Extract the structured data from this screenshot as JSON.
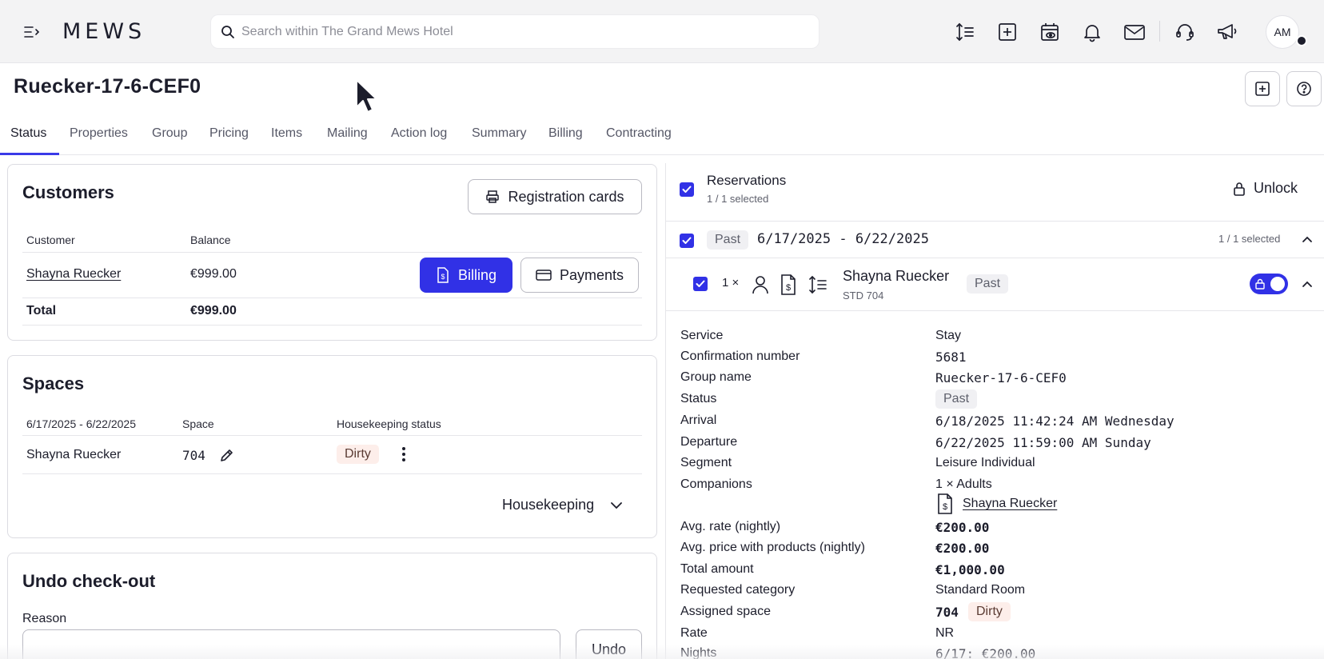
{
  "topbar": {
    "logo": "MEWS",
    "search_placeholder": "Search within The Grand Mews Hotel",
    "avatar_initials": "AM"
  },
  "header": {
    "title": "Ruecker-17-6-CEF0"
  },
  "tabs": [
    "Status",
    "Properties",
    "Group",
    "Pricing",
    "Items",
    "Mailing",
    "Action log",
    "Summary",
    "Billing",
    "Contracting"
  ],
  "customers": {
    "title": "Customers",
    "registration_cards_label": "Registration cards",
    "col_customer": "Customer",
    "col_balance": "Balance",
    "rows": [
      {
        "name": "Shayna Ruecker",
        "balance": "€999.00"
      }
    ],
    "billing_label": "Billing",
    "payments_label": "Payments",
    "total_label": "Total",
    "total_value": "€999.00"
  },
  "spaces": {
    "title": "Spaces",
    "col_dates": "6/17/2025 - 6/22/2025",
    "col_space": "Space",
    "col_hk": "Housekeeping status",
    "row": {
      "guest": "Shayna Ruecker",
      "space": "704",
      "status": "Dirty"
    },
    "housekeeping_label": "Housekeeping"
  },
  "undo_checkout": {
    "title": "Undo check-out",
    "reason_label": "Reason",
    "undo_label": "Undo"
  },
  "reservations": {
    "title": "Reservations",
    "selected": "1 / 1 selected",
    "unlock_label": "Unlock",
    "group_badge": "Past",
    "group_dates": "6/17/2025 - 6/22/2025",
    "group_selected": "1 / 1 selected",
    "item_count": "1 ×",
    "guest_name": "Shayna Ruecker",
    "room_code": "STD 704",
    "item_badge": "Past",
    "details": {
      "service_label": "Service",
      "service": "Stay",
      "confirmation_label": "Confirmation number",
      "confirmation": "5681",
      "group_name_label": "Group name",
      "group_name": "Ruecker-17-6-CEF0",
      "status_label": "Status",
      "status": "Past",
      "arrival_label": "Arrival",
      "arrival": "6/18/2025 11:42:24 AM Wednesday",
      "departure_label": "Departure",
      "departure": "6/22/2025 11:59:00 AM Sunday",
      "segment_label": "Segment",
      "segment": "Leisure Individual",
      "companions_label": "Companions",
      "companions_count": "1 × Adults",
      "companion_name": "Shayna Ruecker",
      "avg_rate_label": "Avg. rate (nightly)",
      "avg_rate": "€200.00",
      "avg_price_label": "Avg. price with products (nightly)",
      "avg_price": "€200.00",
      "total_amount_label": "Total amount",
      "total_amount": "€1,000.00",
      "requested_category_label": "Requested category",
      "requested_category": "Standard Room",
      "assigned_space_label": "Assigned space",
      "assigned_space": "704",
      "assigned_space_status": "Dirty",
      "rate_label": "Rate",
      "rate": "NR",
      "nights_label": "Nights",
      "nights": "6/17: €200.00"
    }
  },
  "colors": {
    "accent": "#3131e6",
    "dirty_bg": "#fdeeea",
    "past_bg": "#f0f0f3"
  }
}
